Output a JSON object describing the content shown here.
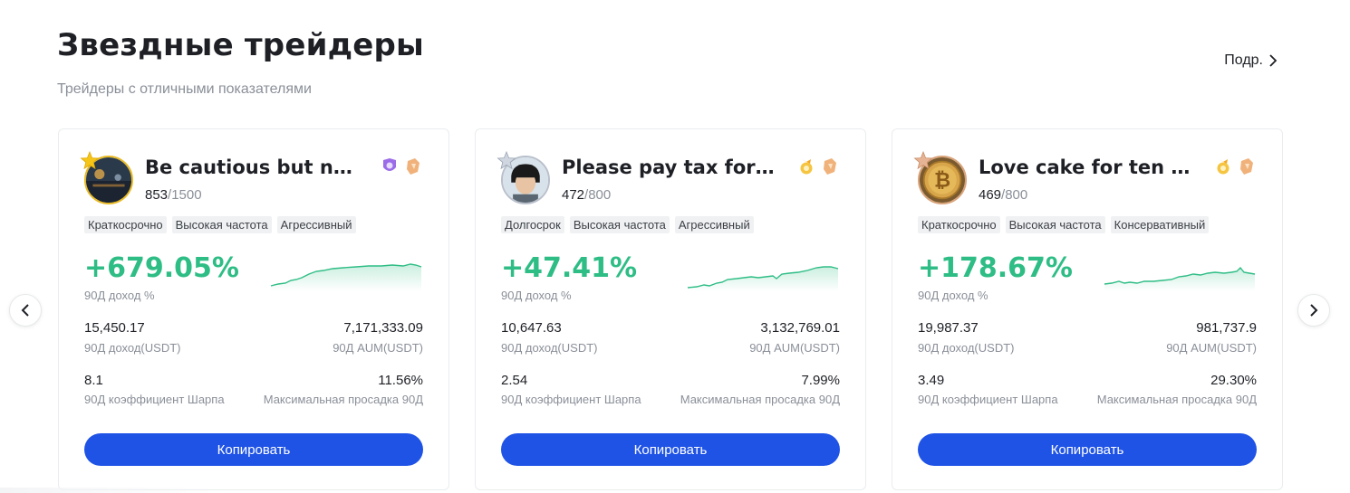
{
  "header": {
    "title": "Звездные трейдеры",
    "subtitle": "Трейдеры с отличными показателями",
    "more_label": "Подр."
  },
  "nav": {
    "prev_icon": "chevron-left-icon",
    "next_icon": "chevron-right-icon"
  },
  "colors": {
    "accent": "#1f53e6",
    "positive": "#2ebd85",
    "muted": "#8a8f98"
  },
  "cards": [
    {
      "name": "Be cautious but no...",
      "followers": "853",
      "followers_max": "/1500",
      "tags": [
        "Краткосрочно",
        "Высокая частота",
        "Агрессивный"
      ],
      "roi": "+679.05%",
      "roi_label": "90Д доход %",
      "pnl": "15,450.17",
      "pnl_label": "90Д доход(USDT)",
      "aum": "7,171,333.09",
      "aum_label": "90Д AUM(USDT)",
      "sharpe": "8.1",
      "sharpe_label": "90Д коэффициент Шарпа",
      "mdd": "11.56%",
      "mdd_label": "Максимальная просадка 90Д",
      "copy_label": "Копировать"
    },
    {
      "name": "Please pay tax for ...",
      "followers": "472",
      "followers_max": "/800",
      "tags": [
        "Долгосрок",
        "Высокая частота",
        "Агрессивный"
      ],
      "roi": "+47.41%",
      "roi_label": "90Д доход %",
      "pnl": "10,647.63",
      "pnl_label": "90Д доход(USDT)",
      "aum": "3,132,769.01",
      "aum_label": "90Д AUM(USDT)",
      "sharpe": "2.54",
      "sharpe_label": "90Д коэффициент Шарпа",
      "mdd": "7.99%",
      "mdd_label": "Максимальная просадка 90Д",
      "copy_label": "Копировать"
    },
    {
      "name": "Love cake for ten t...",
      "followers": "469",
      "followers_max": "/800",
      "tags": [
        "Краткосрочно",
        "Высокая частота",
        "Консервативный"
      ],
      "roi": "+178.67%",
      "roi_label": "90Д доход %",
      "pnl": "19,987.37",
      "pnl_label": "90Д доход(USDT)",
      "aum": "981,737.9",
      "aum_label": "90Д AUM(USDT)",
      "sharpe": "3.49",
      "sharpe_label": "90Д коэффициент Шарпа",
      "mdd": "29.30%",
      "mdd_label": "Максимальная просадка 90Д",
      "copy_label": "Копировать"
    }
  ]
}
